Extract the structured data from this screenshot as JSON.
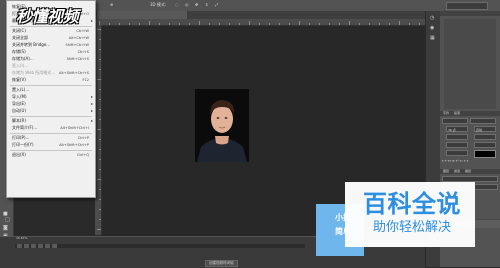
{
  "options_bar": {
    "items": [
      "⊞",
      "◫ ◫",
      "▭ ◫ ▭",
      "⊕",
      "3D 模式"
    ],
    "mode_label": "3D 模式:"
  },
  "doc_tab": {
    "title": ""
  },
  "menu": {
    "items": [
      {
        "label": "恢复(E)",
        "shortcut": "",
        "disabled": false
      },
      {
        "label": "打开(O)...",
        "shortcut": "Ctrl+O",
        "disabled": false
      },
      {
        "label": "最近打开文件(T)",
        "shortcut": "▸",
        "disabled": false
      },
      {
        "label": "",
        "sep": true
      },
      {
        "label": "关闭(C)",
        "shortcut": "Ctrl+W",
        "disabled": false
      },
      {
        "label": "关闭全部",
        "shortcut": "Alt+Ctrl+W",
        "disabled": false
      },
      {
        "label": "关闭并转到 Bridge...",
        "shortcut": "Shift+Ctrl+W",
        "disabled": false
      },
      {
        "label": "存储(S)",
        "shortcut": "Ctrl+S",
        "disabled": false
      },
      {
        "label": "存储为(A)...",
        "shortcut": "Shift+Ctrl+S",
        "disabled": false
      },
      {
        "label": "签入(I)...",
        "shortcut": "",
        "disabled": true
      },
      {
        "label": "存储为 Web 所用格式...",
        "shortcut": "Alt+Shift+Ctrl+S",
        "disabled": true
      },
      {
        "label": "恢复(V)",
        "shortcut": "F12",
        "disabled": false
      },
      {
        "label": "",
        "sep": true
      },
      {
        "label": "置入(L)...",
        "shortcut": "",
        "disabled": false
      },
      {
        "label": "导入(M)",
        "shortcut": "▸",
        "disabled": false
      },
      {
        "label": "导出(E)",
        "shortcut": "▸",
        "disabled": false
      },
      {
        "label": "自动(U)",
        "shortcut": "▸",
        "disabled": false
      },
      {
        "label": "",
        "sep": true
      },
      {
        "label": "脚本(R)",
        "shortcut": "▸",
        "disabled": false
      },
      {
        "label": "文件简介(F)...",
        "shortcut": "Alt+Shift+Ctrl+I",
        "disabled": false
      },
      {
        "label": "",
        "sep": true
      },
      {
        "label": "打印(P)...",
        "shortcut": "Ctrl+P",
        "disabled": false
      },
      {
        "label": "打印一份(Y)",
        "shortcut": "Alt+Shift+Ctrl+P",
        "disabled": false
      },
      {
        "label": "",
        "sep": true
      },
      {
        "label": "退出(X)",
        "shortcut": "Ctrl+Q",
        "disabled": false
      }
    ]
  },
  "logo": {
    "text": "秒懂视频"
  },
  "bottom": {
    "zoom": "16.67%",
    "status": "创建视频时间轴"
  },
  "right_panel": {
    "tabs": [
      "字符",
      "段落"
    ],
    "font_size": "36 点",
    "leading": "自动",
    "layers_tabs": [
      "图层",
      "通道",
      "路径"
    ],
    "layer_name": "背景",
    "color_swatch": "#000000"
  },
  "watermark": {
    "card_line1": "小技",
    "card_line2": "简单",
    "brand": "百科全说",
    "slogan": "助你轻松解决",
    "color": "#2d8fe0"
  }
}
